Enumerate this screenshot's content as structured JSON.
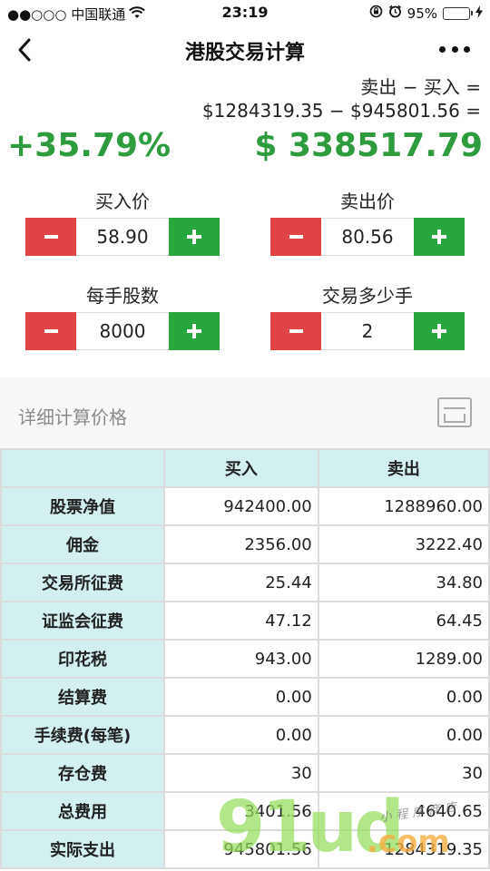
{
  "status_bar": {
    "carrier": "●●○○○ 中国联通",
    "time": "23:19",
    "battery_pct": "95%",
    "battery_level": 0.95
  },
  "nav": {
    "title": "港股交易计算",
    "back_icon": "chevron-left-icon",
    "more_icon": "more-horizontal-icon"
  },
  "summary": {
    "formula_line1": "卖出 − 买入 =",
    "formula_line2": "$1284319.35 − $945801.56 =",
    "percent": "+35.79%",
    "profit": "$ 338517.79",
    "accent_color": "#2e9b3f"
  },
  "inputs": {
    "buy_price": {
      "label": "买入价",
      "value": "58.90"
    },
    "sell_price": {
      "label": "卖出价",
      "value": "80.56"
    },
    "lot_size": {
      "label": "每手股数",
      "value": "8000"
    },
    "lots": {
      "label": "交易多少手",
      "value": "2"
    }
  },
  "detail_section": {
    "title": "详细计算价格",
    "icon": "card-icon"
  },
  "table": {
    "columns": [
      "",
      "买入",
      "卖出"
    ],
    "rows": [
      {
        "label": "股票净值",
        "buy": "942400.00",
        "sell": "1288960.00"
      },
      {
        "label": "佣金",
        "buy": "2356.00",
        "sell": "3222.40"
      },
      {
        "label": "交易所征费",
        "buy": "25.44",
        "sell": "34.80"
      },
      {
        "label": "证监会征费",
        "buy": "47.12",
        "sell": "64.45"
      },
      {
        "label": "印花税",
        "buy": "943.00",
        "sell": "1289.00"
      },
      {
        "label": "结算费",
        "buy": "0.00",
        "sell": "0.00"
      },
      {
        "label": "手续费(每笔)",
        "buy": "0.00",
        "sell": "0.00"
      },
      {
        "label": "存仓费",
        "buy": "30",
        "sell": "30"
      },
      {
        "label": "总费用",
        "buy": "3401.56",
        "sell": "4640.65"
      },
      {
        "label": "实际支出",
        "buy": "945801.56",
        "sell": "1284319.35"
      }
    ]
  },
  "watermark": {
    "brand": "91ud",
    "suffix": ".com",
    "tagline": "小程序商店"
  },
  "colors": {
    "minus": "#e04444",
    "plus": "#28a83c",
    "table_head": "#d3eff0"
  }
}
